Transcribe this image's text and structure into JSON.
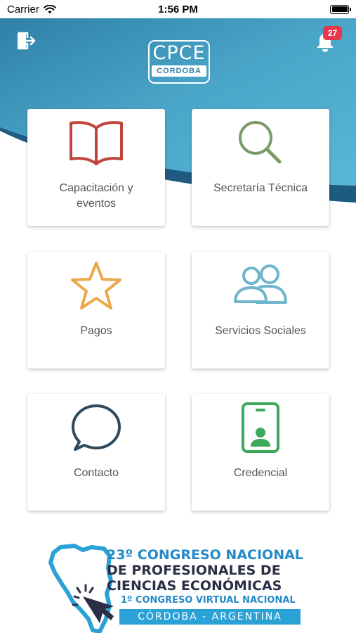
{
  "status_bar": {
    "carrier": "Carrier",
    "time": "1:56 PM"
  },
  "header": {
    "logo_top": "CPCE",
    "logo_bottom": "CORDOBA",
    "notifications_count": "27",
    "colors": {
      "primary": "#4aa6c8",
      "dark_wave": "#1f5a80"
    }
  },
  "menu": [
    {
      "label": "Capacitación y eventos",
      "icon": "book-icon",
      "color": "#c0443c"
    },
    {
      "label": "Secretaría Técnica",
      "icon": "search-icon",
      "color": "#7a9a6a"
    },
    {
      "label": "Pagos",
      "icon": "star-icon",
      "color": "#eaa84a"
    },
    {
      "label": "Servicios Sociales",
      "icon": "users-icon",
      "color": "#6fb5cc"
    },
    {
      "label": "Contacto",
      "icon": "chat-bubble-icon",
      "color": "#2e4a5c"
    },
    {
      "label": "Credencial",
      "icon": "id-card-icon",
      "color": "#3ea85a"
    }
  ],
  "banner": {
    "line1": "23º CONGRESO NACIONAL",
    "line2": "DE PROFESIONALES DE",
    "line3": "CIENCIAS ECONÓMICAS",
    "line4": "1º CONGRESO VIRTUAL NACIONAL",
    "line5": "CÓRDOBA - ARGENTINA"
  }
}
